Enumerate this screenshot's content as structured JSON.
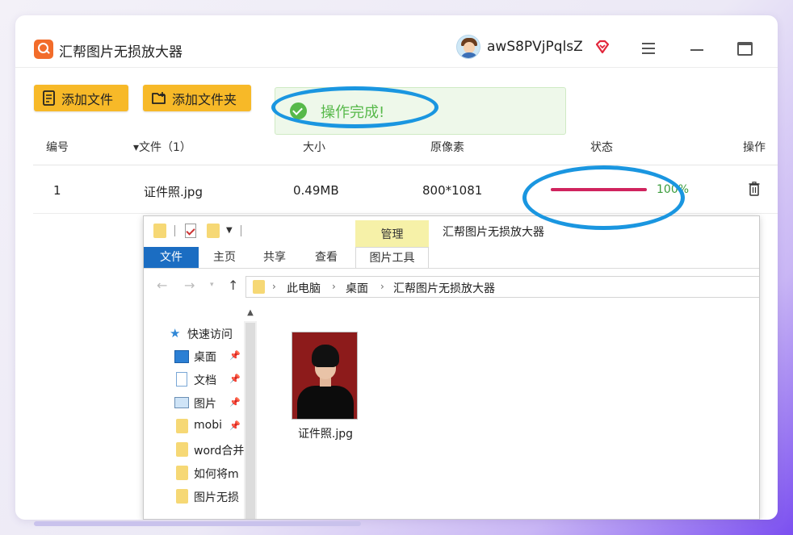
{
  "app": {
    "title": "汇帮图片无损放大器",
    "username": "awS8PVjPqlsZ"
  },
  "toolbar": {
    "add_file": "添加文件",
    "add_folder": "添加文件夹"
  },
  "toast": {
    "message": "操作完成!"
  },
  "table": {
    "headers": {
      "index": "编号",
      "file": "▾文件（1）",
      "size": "大小",
      "pixels": "原像素",
      "status": "状态",
      "action": "操作"
    },
    "rows": [
      {
        "index": "1",
        "file": "证件照.jpg",
        "size": "0.49MB",
        "pixels": "800*1081",
        "progress": 1.0,
        "progress_text": "100%"
      }
    ]
  },
  "explorer": {
    "ribbon_manage": "管理",
    "window_title": "汇帮图片无损放大器",
    "tabs": {
      "file": "文件",
      "home": "主页",
      "share": "共享",
      "view": "查看",
      "picture_tools": "图片工具"
    },
    "breadcrumb": [
      "此电脑",
      "桌面",
      "汇帮图片无损放大器"
    ],
    "nav": {
      "quick_access": "快速访问",
      "items": [
        {
          "label": "桌面",
          "icon": "desktop-icon",
          "pinned": true
        },
        {
          "label": "文档",
          "icon": "document-icon",
          "pinned": true
        },
        {
          "label": "图片",
          "icon": "pictures-icon",
          "pinned": true
        },
        {
          "label": "mobi",
          "icon": "folder-icon",
          "pinned": true
        },
        {
          "label": "word合并",
          "icon": "folder-icon",
          "pinned": false
        },
        {
          "label": "如何将m",
          "icon": "folder-icon",
          "pinned": false
        },
        {
          "label": "图片无损",
          "icon": "folder-icon",
          "pinned": false
        }
      ]
    },
    "files": [
      {
        "name": "证件照.jpg"
      }
    ]
  },
  "colors": {
    "button": "#f7b928",
    "success": "#57b94a",
    "progress": "#d0245e",
    "highlight_ring": "#1a96e0",
    "file_tab": "#1b6dc2"
  }
}
